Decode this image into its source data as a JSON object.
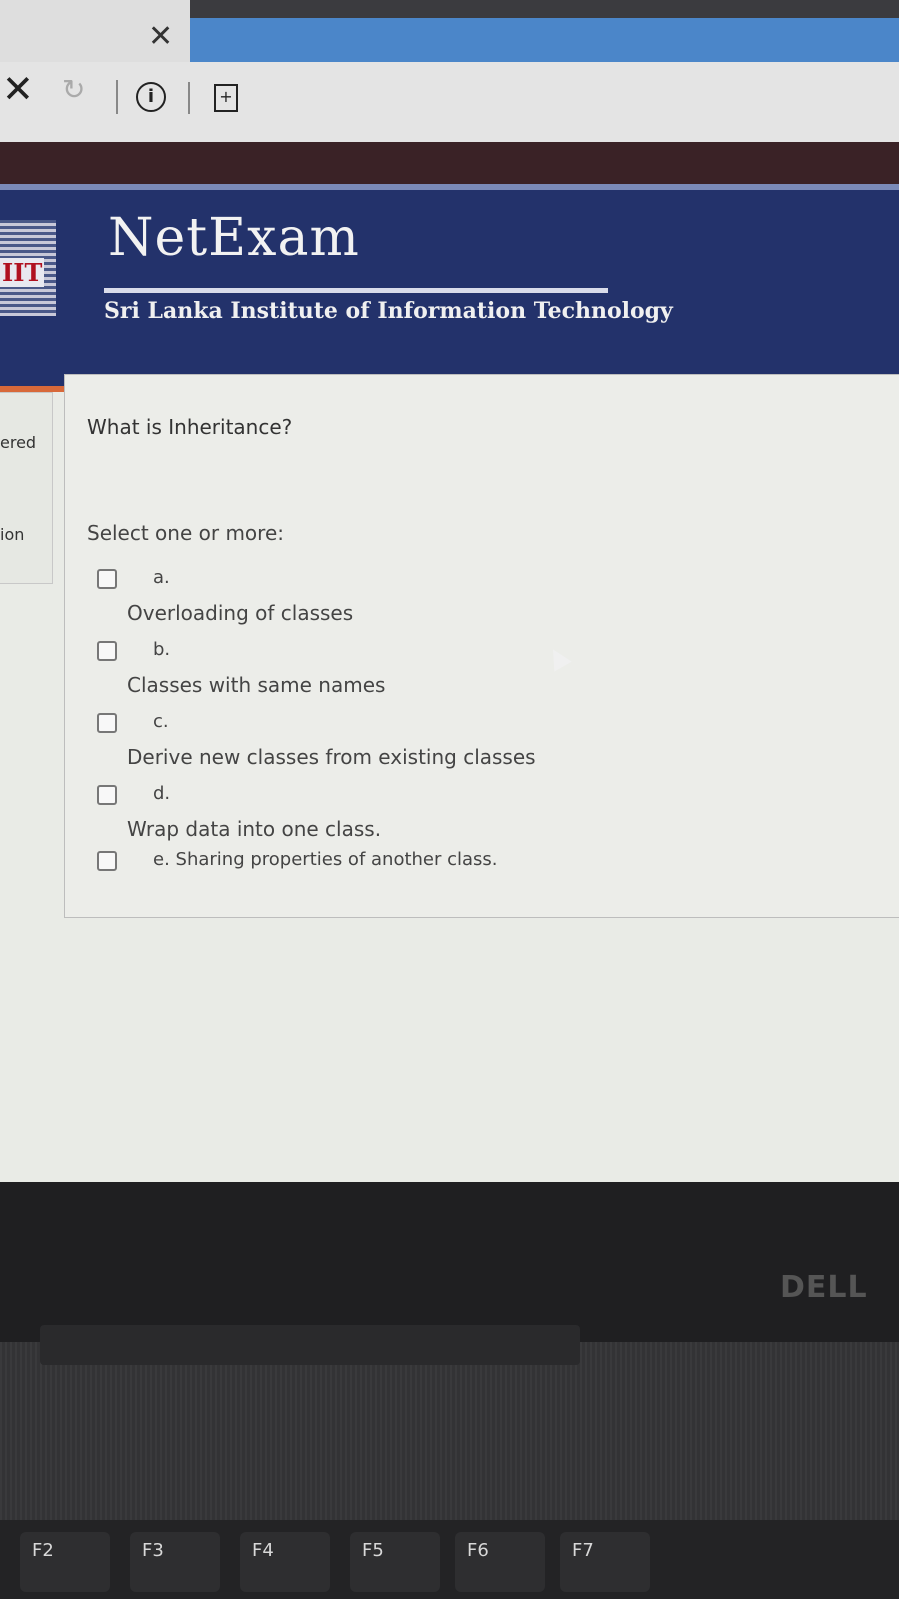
{
  "browser": {
    "tab_close_glyph": "✕",
    "nav": {
      "stop_glyph": "✕",
      "reload_glyph": "↻",
      "info_glyph": "i",
      "page_glyph": "+"
    }
  },
  "header": {
    "brand": "NetExam",
    "institute": "Sri Lanka Institute of Information Technology",
    "logo_text": "IIT"
  },
  "sidebar": {
    "line1": "ered",
    "line2": "ion"
  },
  "question": {
    "text": "What is Inheritance?",
    "instruction": "Select one or more:",
    "options": [
      {
        "letter": "a.",
        "text": "Overloading of classes"
      },
      {
        "letter": "b.",
        "text": "Classes with same names"
      },
      {
        "letter": "c.",
        "text": "Derive new classes from existing classes"
      },
      {
        "letter": "d.",
        "text": "Wrap data into one class."
      },
      {
        "letter": "e.",
        "text": "Sharing properties of another class."
      }
    ]
  },
  "laptop": {
    "brand": "DELL",
    "keys": [
      "F2",
      "F3",
      "F4",
      "F5",
      "F6",
      "F7"
    ]
  },
  "colors": {
    "header_bg": "#23326b",
    "accent_orange": "#d8693a",
    "address_bar": "#4b86c9"
  }
}
